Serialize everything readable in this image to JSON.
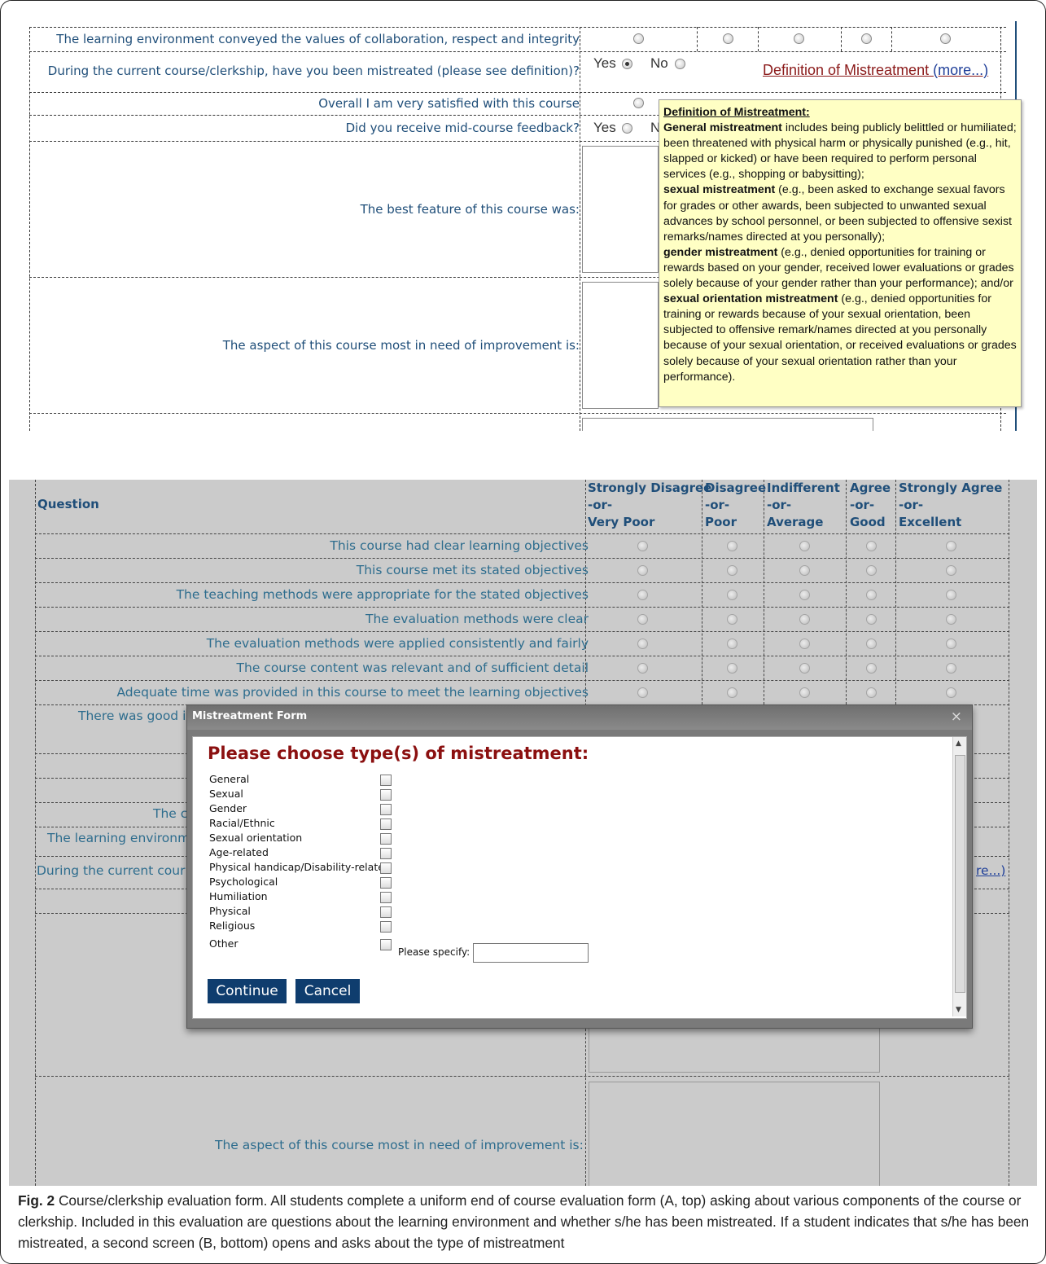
{
  "panelA": {
    "questions": {
      "learning_env": "The learning environment conveyed the values of collaboration, respect and integrity",
      "mistreated": "During the current course/clerkship, have you been mistreated (please see definition)?",
      "satisfied": "Overall I am very satisfied with this course",
      "midcourse": "Did you receive mid-course feedback?",
      "best_feature": "The best feature of this course was:",
      "improvement": "The aspect of this course most in need of improvement is:"
    },
    "yes_label": "Yes",
    "no_label": "No",
    "no_partial": "N",
    "definition_link": "Definition of Mistreatment",
    "more_link": "(more...)",
    "tooltip": {
      "title": "Definition of Mistreatment:",
      "general_bold": "General mistreatment",
      "general_text": " includes being publicly belittled or humiliated; been threatened with physical harm or physically punished (e.g., hit, slapped or kicked) or have been required to perform personal services (e.g., shopping or babysitting);",
      "sexual_bold": "sexual mistreatment",
      "sexual_text": " (e.g., been asked to exchange sexual favors for grades or other awards, been subjected to unwanted sexual advances by school personnel, or been subjected to offensive sexist remarks/names directed at you personally);",
      "gender_bold": "gender mistreatment",
      "gender_text": " (e.g., denied opportunities for training or rewards based on your gender, received lower evaluations or grades solely because of your gender rather than your performance); and/or",
      "orientation_bold": "sexual orientation mistreatment",
      "orientation_text": " (e.g., denied opportunities for training or rewards because of your sexual orientation, been subjected to offensive remark/names directed at you personally because of your sexual orientation, or received evaluations or grades solely because of your sexual orientation rather than your performance)."
    }
  },
  "panelB": {
    "question_header": "Question",
    "scale": [
      {
        "l1": "Strongly Disagree",
        "l2": "-or-",
        "l3": "Very Poor"
      },
      {
        "l1": "Disagree",
        "l2": "-or-",
        "l3": "Poor"
      },
      {
        "l1": "Indifferent",
        "l2": "-or-",
        "l3": "Average"
      },
      {
        "l1": "Agree",
        "l2": "-or-",
        "l3": "Good"
      },
      {
        "l1": "Strongly Agree",
        "l2": "-or-",
        "l3": "Excellent"
      }
    ],
    "rows": [
      "This course had clear learning objectives",
      "This course met its stated objectives",
      "The teaching methods were appropriate for the stated objectives",
      "The evaluation methods were clear",
      "The evaluation methods were applied consistently and fairly",
      "The course content was relevant and of sufficient detail",
      "Adequate time was provided in this course to meet the learning objectives"
    ],
    "partial": {
      "there_was": "There was good i",
      "the_c": "The c",
      "learning_env": "The learning environm",
      "during": "During the current cour",
      "more_frag": "re...)",
      "improvement": "The aspect of this course most in need of improvement is:"
    },
    "modal": {
      "title": "Mistreatment Form",
      "close": "×",
      "heading": "Please choose type(s) of mistreatment:",
      "options": [
        "General",
        "Sexual",
        "Gender",
        "Racial/Ethnic",
        "Sexual orientation",
        "Age-related",
        "Physical handicap/Disability-related",
        "Psychological",
        "Humiliation",
        "Physical",
        "Religious",
        "Other"
      ],
      "specify_label": "Please specify:",
      "continue": "Continue",
      "cancel": "Cancel"
    }
  },
  "caption": {
    "label": "Fig. 2",
    "text": " Course/clerkship evaluation form. All students complete a uniform end of course evaluation form (A, top) asking about various components of the course or clerkship. Included in this evaluation are questions about the learning environment and whether s/he has been mistreated. If a student indicates that s/he has been mistreated, a second screen (B, bottom) opens and asks about the type of mistreatment"
  }
}
